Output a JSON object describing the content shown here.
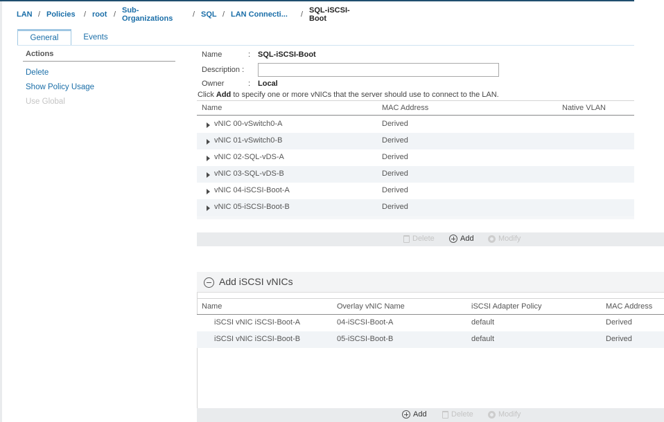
{
  "breadcrumb": {
    "items": [
      "LAN",
      "Policies",
      "root",
      "Sub-",
      "Organizations",
      "SQL",
      "LAN Connecti..."
    ],
    "current_line1": "SQL-iSCSI-",
    "current_line2": "Boot"
  },
  "tabs": [
    "General",
    "Events"
  ],
  "actions": {
    "title": "Actions",
    "items": [
      "Delete",
      "Show Policy Usage",
      "Use Global"
    ]
  },
  "form": {
    "name_label": "Name",
    "name_value": "SQL-iSCSI-Boot",
    "description_label": "Description :",
    "description_value": "",
    "owner_label": "Owner",
    "owner_value": "Local",
    "colon": ":"
  },
  "hint": {
    "prefix": "Click ",
    "bold": "Add",
    "suffix": " to specify one or more vNICs that the server should use to connect to the LAN."
  },
  "vnic_table": {
    "columns": [
      "Name",
      "MAC Address",
      "Native VLAN"
    ],
    "rows": [
      {
        "name": "vNIC 00-vSwitch0-A",
        "mac": "Derived"
      },
      {
        "name": "vNIC 01-vSwitch0-B",
        "mac": "Derived"
      },
      {
        "name": "vNIC 02-SQL-vDS-A",
        "mac": "Derived"
      },
      {
        "name": "vNIC 03-SQL-vDS-B",
        "mac": "Derived"
      },
      {
        "name": "vNIC 04-iSCSI-Boot-A",
        "mac": "Derived"
      },
      {
        "name": "vNIC 05-iSCSI-Boot-B",
        "mac": "Derived"
      }
    ],
    "toolbar": {
      "delete": "Delete",
      "add": "Add",
      "modify": "Modify"
    }
  },
  "iscsi_panel": {
    "title": "Add iSCSI vNICs",
    "columns": [
      "Name",
      "Overlay vNIC Name",
      "iSCSI Adapter Policy",
      "MAC Address"
    ],
    "rows": [
      {
        "name": "iSCSI vNIC iSCSI-Boot-A",
        "overlay": "04-iSCSI-Boot-A",
        "policy": "default",
        "mac": "Derived"
      },
      {
        "name": "iSCSI vNIC iSCSI-Boot-B",
        "overlay": "05-iSCSI-Boot-B",
        "policy": "default",
        "mac": "Derived"
      }
    ],
    "toolbar": {
      "add": "Add",
      "delete": "Delete",
      "modify": "Modify"
    }
  },
  "colors": {
    "link": "#1a6ea8",
    "disabled": "#c4c4c4",
    "toolbar_bg": "#e9ebed"
  }
}
